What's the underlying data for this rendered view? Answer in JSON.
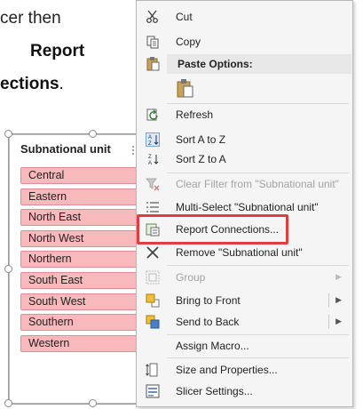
{
  "instructions": {
    "line1": "cer then",
    "line2": "Report",
    "line3_bold": "ections",
    "line3_tail": "."
  },
  "slicer": {
    "header": "Subnational unit",
    "items": [
      "Central",
      "Eastern",
      "North East",
      "North West",
      "Northern",
      "South East",
      "South West",
      "Southern",
      "Western"
    ],
    "item_fill": "#f7b9bb"
  },
  "menu": {
    "cut": "Cut",
    "copy": "Copy",
    "paste_options": "Paste Options:",
    "refresh": "Refresh",
    "sort_az": "Sort A to Z",
    "sort_za": "Sort Z to A",
    "clear_filter": "Clear Filter from \"Subnational unit\"",
    "multi_select": "Multi-Select \"Subnational unit\"",
    "report_connections": "Report Connections...",
    "remove": "Remove \"Subnational unit\"",
    "group": "Group",
    "bring_front": "Bring to Front",
    "send_back": "Send to Back",
    "assign_macro": "Assign Macro...",
    "size_props": "Size and Properties...",
    "slicer_settings": "Slicer Settings..."
  },
  "highlight_color": "#e23c3c"
}
